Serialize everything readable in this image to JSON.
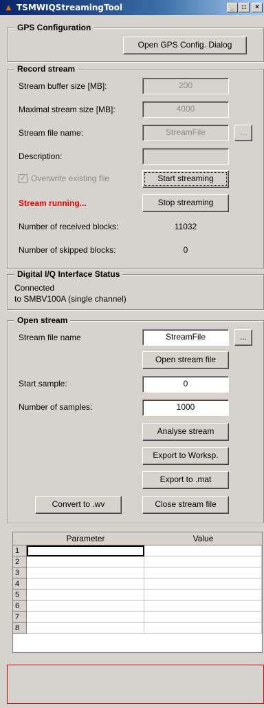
{
  "window": {
    "title": "TSMWIQStreamingTool",
    "icon": "matlab-icon",
    "controls": [
      "minimize",
      "maximize",
      "close"
    ]
  },
  "gps": {
    "title": "GPS Configuration",
    "open_dialog_button": "Open GPS Config. Dialog"
  },
  "record": {
    "title": "Record stream",
    "buffer_label": "Stream buffer size [MB]:",
    "buffer_value": "200",
    "max_size_label": "Maximal stream size [MB]:",
    "max_size_value": "4000",
    "file_name_label": "Stream file name:",
    "file_name_value": "StreamFile",
    "browse_button": "...",
    "description_label": "Description:",
    "description_value": "",
    "overwrite_label": "Overwrite existing file",
    "overwrite_checked": true,
    "start_button": "Start streaming",
    "status_text": "Stream running...",
    "stop_button": "Stop streaming",
    "received_label": "Number of received blocks:",
    "received_value": "11032",
    "skipped_label": "Number of skipped blocks:",
    "skipped_value": "0"
  },
  "digital": {
    "title": "Digital I/Q Interface Status",
    "line1": "Connected",
    "line2": "to SMBV100A (single channel)"
  },
  "open": {
    "title": "Open stream",
    "file_name_label": "Stream file name",
    "file_name_value": "StreamFile",
    "browse_button": "...",
    "open_button": "Open stream file",
    "start_sample_label": "Start sample:",
    "start_sample_value": "0",
    "num_samples_label": "Number of samples:",
    "num_samples_value": "1000",
    "analyse_button": "Analyse stream",
    "export_ws_button": "Export to Worksp.",
    "export_mat_button": "Export to .mat",
    "convert_button": "Convert to .wv",
    "close_button": "Close stream file"
  },
  "table": {
    "columns": [
      "Parameter",
      "Value"
    ],
    "rows": [
      {
        "index": "1",
        "parameter": "",
        "value": ""
      },
      {
        "index": "2",
        "parameter": "",
        "value": ""
      },
      {
        "index": "3",
        "parameter": "",
        "value": ""
      },
      {
        "index": "4",
        "parameter": "",
        "value": ""
      },
      {
        "index": "5",
        "parameter": "",
        "value": ""
      },
      {
        "index": "6",
        "parameter": "",
        "value": ""
      },
      {
        "index": "7",
        "parameter": "",
        "value": ""
      },
      {
        "index": "8",
        "parameter": "",
        "value": ""
      }
    ]
  },
  "colors": {
    "titlebar": "#0a246a",
    "status_red": "#e00000",
    "face": "#d6d3ce"
  }
}
